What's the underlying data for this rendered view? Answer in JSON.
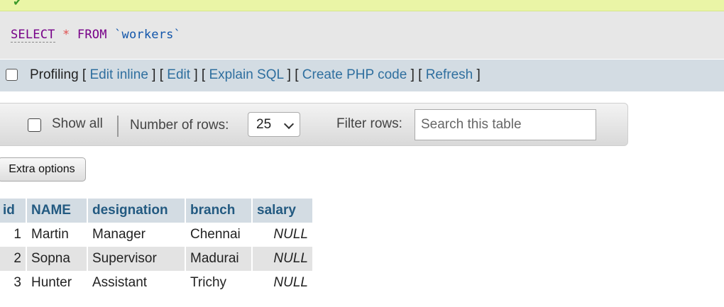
{
  "sql": {
    "keyword_select": "SELECT",
    "star": "*",
    "keyword_from": "FROM",
    "table": "`workers`"
  },
  "options_bar": {
    "profiling": "Profiling",
    "links": [
      "Edit inline",
      "Edit",
      "Explain SQL",
      "Create PHP code",
      "Refresh"
    ]
  },
  "navigation": {
    "show_all": "Show all",
    "rows_label": "Number of rows:",
    "rows_value": "25",
    "filter_label": "Filter rows:",
    "search_placeholder": "Search this table"
  },
  "extra_options": "Extra options",
  "results": {
    "columns": [
      "id",
      "NAME",
      "designation",
      "branch",
      "salary"
    ],
    "rows": [
      [
        "1",
        "Martin",
        "Manager",
        "Chennai",
        "NULL"
      ],
      [
        "2",
        "Sopna",
        "Supervisor",
        "Madurai",
        "NULL"
      ],
      [
        "3",
        "Hunter",
        "Assistant",
        "Trichy",
        "NULL"
      ]
    ]
  },
  "colors": {
    "header_bg": "#d3dce3",
    "header_text": "#235a81",
    "link": "#2f6f9f",
    "keyword": "#770088",
    "table_name": "#1155aa",
    "success_strip": "#eaf5a6"
  }
}
